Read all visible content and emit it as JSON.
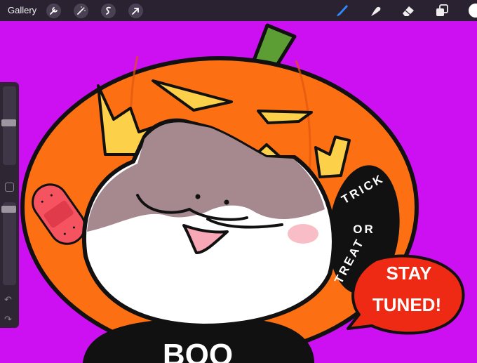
{
  "topbar": {
    "gallery_label": "Gallery",
    "left_tools": [
      {
        "name": "wrench-icon"
      },
      {
        "name": "magic-wand-icon"
      },
      {
        "name": "selection-icon"
      },
      {
        "name": "transform-arrow-icon"
      }
    ],
    "right_tools": [
      {
        "name": "brush-icon"
      },
      {
        "name": "smudge-icon"
      },
      {
        "name": "eraser-icon"
      },
      {
        "name": "layers-icon"
      }
    ],
    "current_color": "#ffffff",
    "accent_color": "#2f8bff"
  },
  "sidebar": {
    "brush_size_level": 0.46,
    "opacity_level": 0.05,
    "undo_icon": "undo-icon",
    "redo_icon": "redo-icon"
  },
  "artwork": {
    "background_color": "#cc10f2",
    "sign_text": [
      "TRICK",
      "OR",
      "TREAT"
    ],
    "bubble_lines": [
      "STAY",
      "TUNED!"
    ],
    "shirt_text": "BOO"
  }
}
